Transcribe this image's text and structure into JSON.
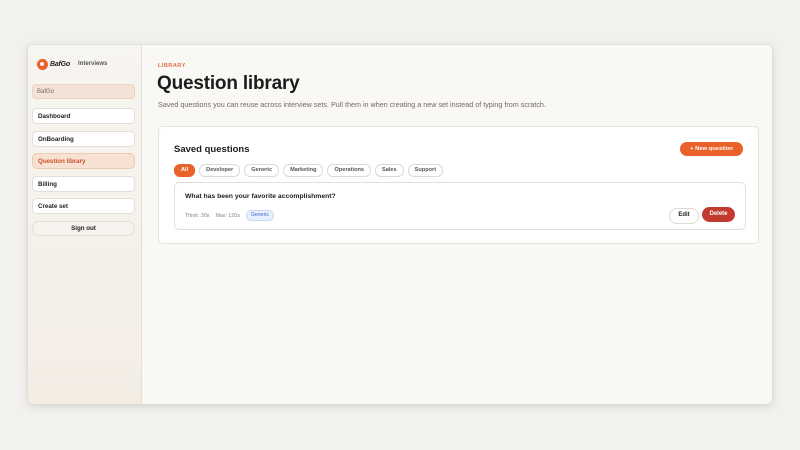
{
  "brand": {
    "name": "BafGo",
    "section": "Interviews"
  },
  "sidebar": {
    "org": "BafGo",
    "items": [
      {
        "label": "Dashboard"
      },
      {
        "label": "OnBoarding"
      },
      {
        "label": "Question library"
      },
      {
        "label": "Billing"
      },
      {
        "label": "Create set"
      }
    ],
    "active_index": 2,
    "signout_label": "Sign out"
  },
  "header": {
    "eyebrow": "LIBRARY",
    "title": "Question library",
    "subtitle": "Saved questions you can reuse across interview sets. Pull them in when creating a new set instead of typing from scratch."
  },
  "saved": {
    "title": "Saved questions",
    "new_button": "+ New question",
    "filters": [
      "All",
      "Developer",
      "Generic",
      "Marketing",
      "Operations",
      "Sales",
      "Support"
    ],
    "active_filter": "All",
    "questions": [
      {
        "text": "What has been your favorite accomplishment?",
        "think": "Think: 30s",
        "max": "Max: 120s",
        "tag": "Generic",
        "edit_label": "Edit",
        "delete_label": "Delete"
      }
    ]
  },
  "colors": {
    "accent": "#e8622a",
    "danger": "#c23a2e",
    "tag_blue": "#3d6bc7"
  }
}
